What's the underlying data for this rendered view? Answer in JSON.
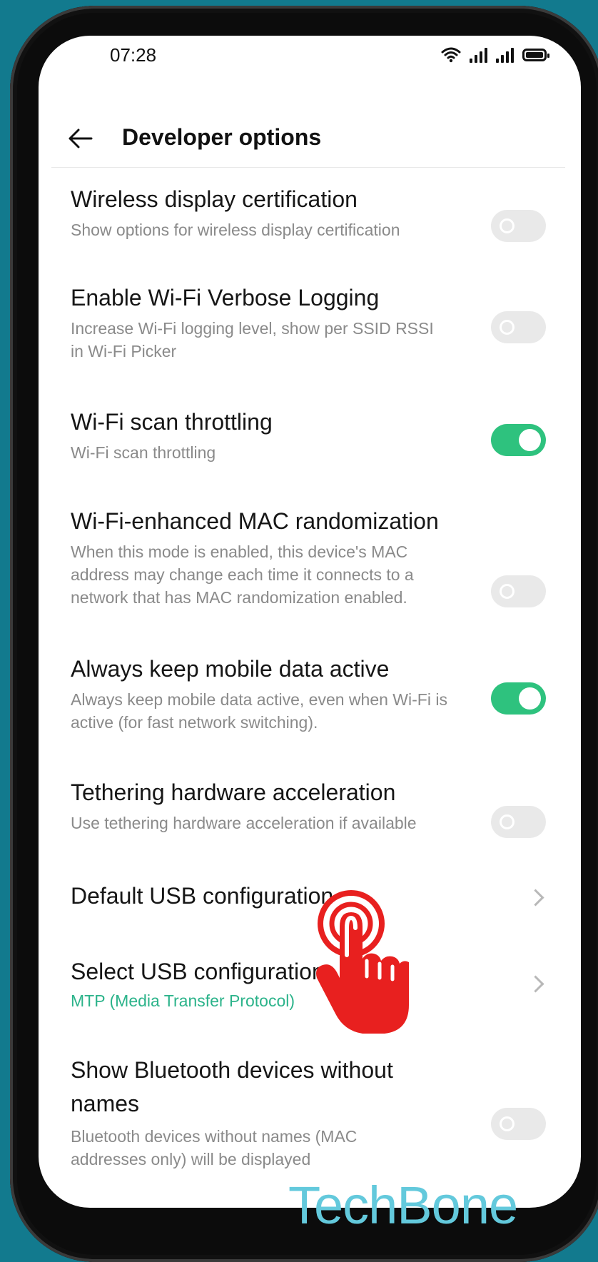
{
  "status_bar": {
    "time": "07:28"
  },
  "header": {
    "title": "Developer options"
  },
  "settings": [
    {
      "title": "Wireless display certification",
      "subtitle": "Show options for wireless display certification",
      "control": "toggle",
      "enabled": false
    },
    {
      "title": "Enable Wi-Fi Verbose Logging",
      "subtitle": "Increase Wi-Fi logging level, show per SSID RSSI in Wi-Fi Picker",
      "control": "toggle",
      "enabled": false
    },
    {
      "title": "Wi-Fi scan throttling",
      "subtitle": "Wi-Fi scan throttling",
      "control": "toggle",
      "enabled": true
    },
    {
      "title": "Wi-Fi-enhanced MAC randomization",
      "subtitle": "When this mode is enabled, this device's MAC address may change each time it connects to a network that has MAC randomization enabled.",
      "control": "toggle",
      "enabled": false
    },
    {
      "title": "Always keep mobile data active",
      "subtitle": "Always keep mobile data active, even when Wi-Fi is active (for fast network switching).",
      "control": "toggle",
      "enabled": true
    },
    {
      "title": "Tethering hardware acceleration",
      "subtitle": "Use tethering hardware acceleration if available",
      "control": "toggle",
      "enabled": false
    },
    {
      "title": "Default USB configuration",
      "control": "chevron"
    },
    {
      "title": "Select USB configuration",
      "subtitle": "MTP (Media Transfer Protocol)",
      "control": "chevron"
    },
    {
      "title": "Show Bluetooth devices without names",
      "subtitle": "Bluetooth devices without names (MAC addresses only) will be displayed",
      "control": "toggle",
      "enabled": false
    }
  ],
  "colors": {
    "accent": "#2ec27e",
    "accent_text": "#2bb38a",
    "tap_indicator": "#e8201f",
    "watermark": "#63c9dc"
  },
  "overlay": {
    "tap_icon": "tap-hand-icon",
    "watermark": "TechBone"
  }
}
